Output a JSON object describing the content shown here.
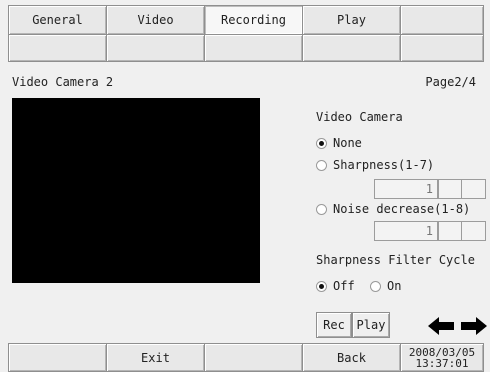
{
  "tabs": [
    {
      "label": "General"
    },
    {
      "label": "Video"
    },
    {
      "label": "Recording"
    },
    {
      "label": "Play"
    },
    {
      "label": ""
    }
  ],
  "header": {
    "camera_name": "Video Camera 2",
    "page_indicator": "Page2/4"
  },
  "video_camera": {
    "title": "Video Camera",
    "options": [
      "None",
      "Sharpness(1-7)",
      "Noise decrease(1-8)"
    ],
    "selected": "None",
    "sharpness_value": "1",
    "noise_value": "1"
  },
  "sharpness_filter": {
    "title": "Sharpness Filter Cycle",
    "options": [
      "Off",
      "On"
    ],
    "selected": "Off"
  },
  "buttons": {
    "rec": "Rec",
    "play": "Play"
  },
  "footer": {
    "exit": "Exit",
    "back": "Back",
    "date": "2008/03/05",
    "time": "13:37:01"
  }
}
